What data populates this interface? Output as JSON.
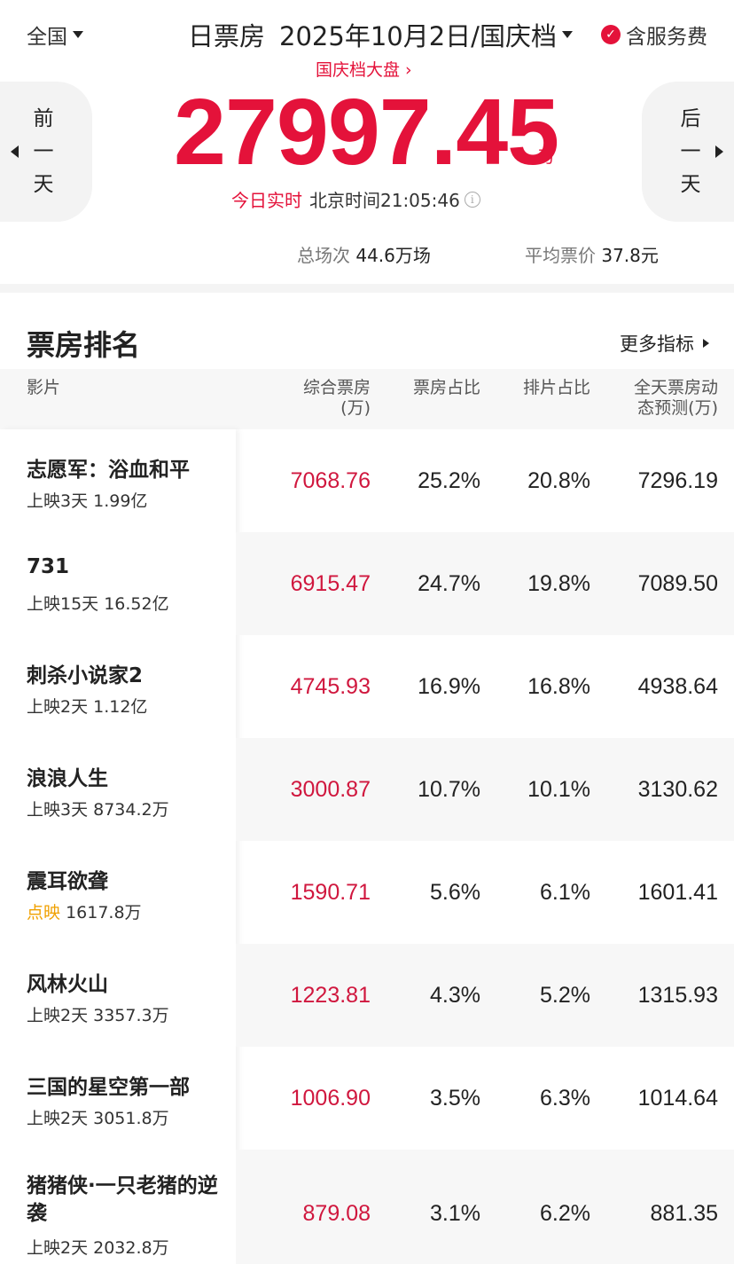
{
  "header": {
    "region": "全国",
    "title_prefix": "日票房",
    "date": "2025年10月2日/国庆档",
    "service_fee": "含服务费",
    "sublink": "国庆档大盘 ›",
    "prev_day": [
      "前",
      "一",
      "天"
    ],
    "next_day": [
      "后",
      "一",
      "天"
    ],
    "total_box_office": "27997.45",
    "total_unit": "万",
    "realtime_label": "今日实时",
    "realtime_time": "北京时间21:05:46",
    "stats": {
      "shows_label": "总场次",
      "shows_value": "44.6万场",
      "price_label": "平均票价",
      "price_value": "37.8元"
    }
  },
  "ranking": {
    "title": "票房排名",
    "more": "更多指标",
    "columns": {
      "film": "影片",
      "box_office": [
        "综合票房",
        "(万)"
      ],
      "bo_share": "票房占比",
      "show_share": "排片占比",
      "prediction": [
        "全天票房动",
        "态预测(万)"
      ]
    },
    "rows": [
      {
        "name": "志愿军：浴血和平",
        "tag": "",
        "meta": "上映3天 1.99亿",
        "box_office": "7068.76",
        "bo_share": "25.2%",
        "show_share": "20.8%",
        "prediction": "7296.19"
      },
      {
        "name": "731",
        "tag": "",
        "meta": "上映15天 16.52亿",
        "box_office": "6915.47",
        "bo_share": "24.7%",
        "show_share": "19.8%",
        "prediction": "7089.50"
      },
      {
        "name": "刺杀小说家2",
        "tag": "",
        "meta": "上映2天 1.12亿",
        "box_office": "4745.93",
        "bo_share": "16.9%",
        "show_share": "16.8%",
        "prediction": "4938.64"
      },
      {
        "name": "浪浪人生",
        "tag": "",
        "meta": "上映3天 8734.2万",
        "box_office": "3000.87",
        "bo_share": "10.7%",
        "show_share": "10.1%",
        "prediction": "3130.62"
      },
      {
        "name": "震耳欲聋",
        "tag": "点映",
        "meta": "1617.8万",
        "box_office": "1590.71",
        "bo_share": "5.6%",
        "show_share": "6.1%",
        "prediction": "1601.41"
      },
      {
        "name": "风林火山",
        "tag": "",
        "meta": "上映2天 3357.3万",
        "box_office": "1223.81",
        "bo_share": "4.3%",
        "show_share": "5.2%",
        "prediction": "1315.93"
      },
      {
        "name": "三国的星空第一部",
        "tag": "",
        "meta": "上映2天 3051.8万",
        "box_office": "1006.90",
        "bo_share": "3.5%",
        "show_share": "6.3%",
        "prediction": "1014.64"
      },
      {
        "name": "猪猪侠·一只老猪的逆袭",
        "tag": "",
        "meta": "上映2天 2032.8万",
        "box_office": "879.08",
        "bo_share": "3.1%",
        "show_share": "6.2%",
        "prediction": "881.35"
      }
    ]
  },
  "colors": {
    "accent_red": "#e4123a",
    "box_office_red": "#d0173e",
    "preview_tag": "#f0a000"
  }
}
